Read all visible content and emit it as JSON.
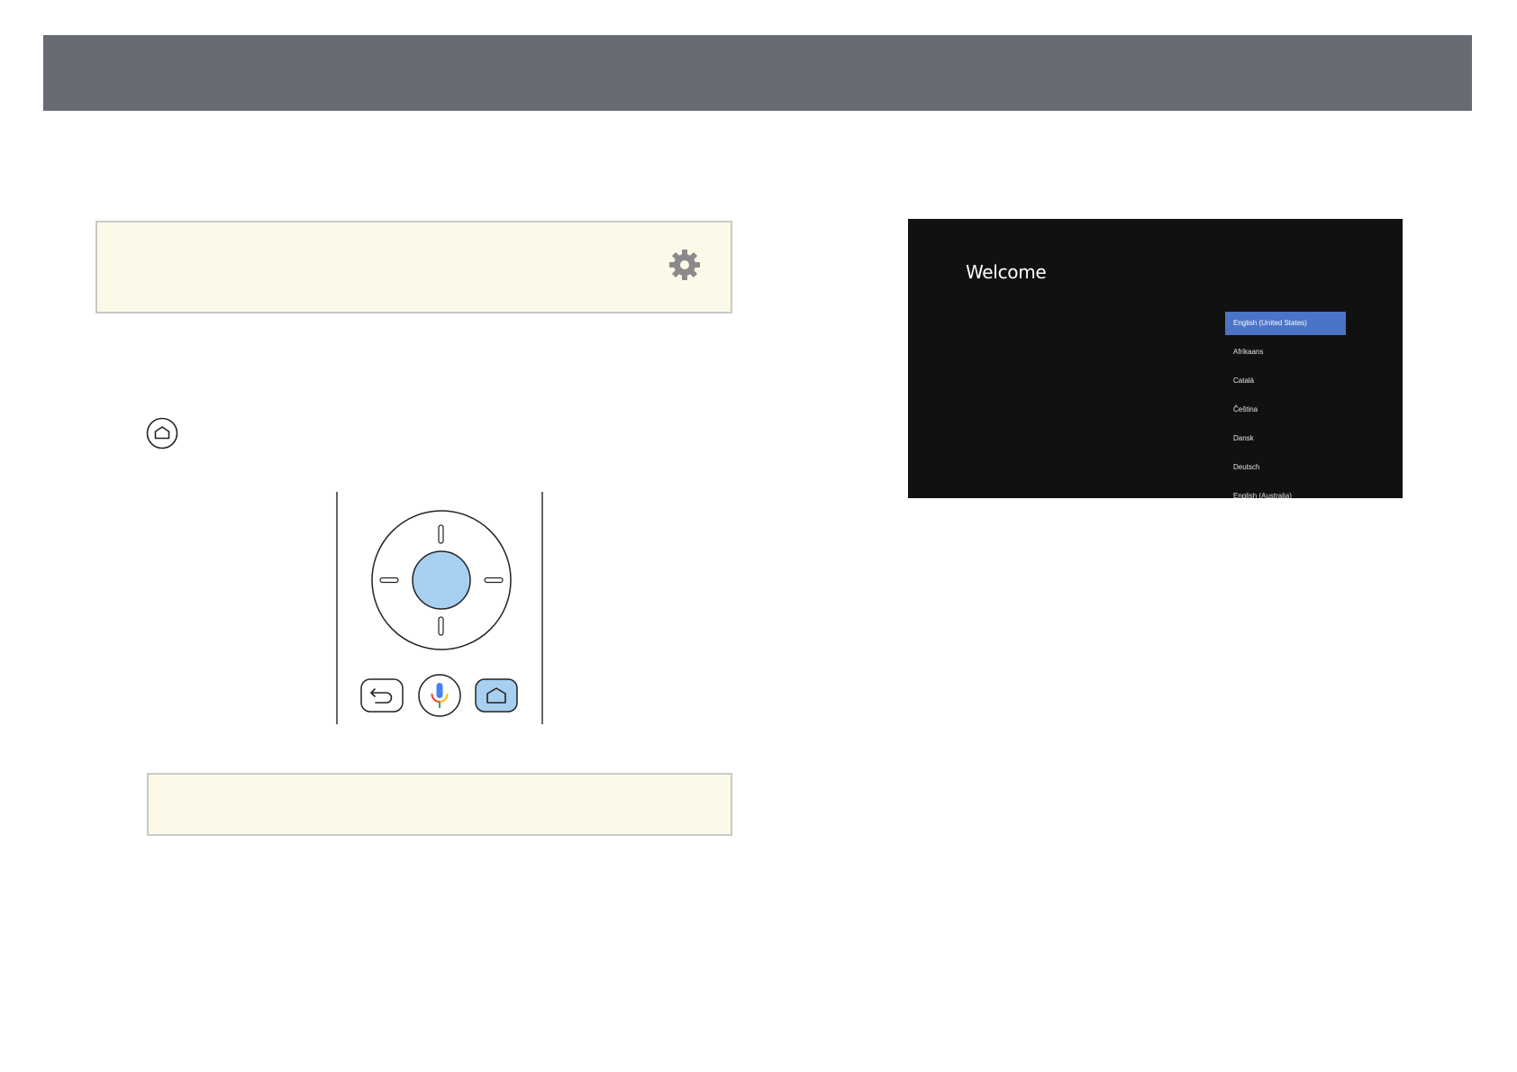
{
  "screen": {
    "title": "Welcome",
    "languages": [
      {
        "label": "English (United States)",
        "selected": true
      },
      {
        "label": "Afrikaans",
        "selected": false
      },
      {
        "label": "Català",
        "selected": false
      },
      {
        "label": "Čeština",
        "selected": false
      },
      {
        "label": "Dansk",
        "selected": false
      },
      {
        "label": "Deutsch",
        "selected": false
      },
      {
        "label": "English (Australia)",
        "selected": false
      }
    ]
  },
  "icons": {
    "note_top": "gear-icon",
    "step_home": "home-icon",
    "remote_buttons": [
      "back-icon",
      "microphone-icon",
      "home-icon"
    ]
  },
  "colors": {
    "header": "#686b74",
    "note_background": "#fdf9e8",
    "highlight": "#a7cff0",
    "selected_language": "#4b73c6",
    "screen_background": "#111111"
  }
}
